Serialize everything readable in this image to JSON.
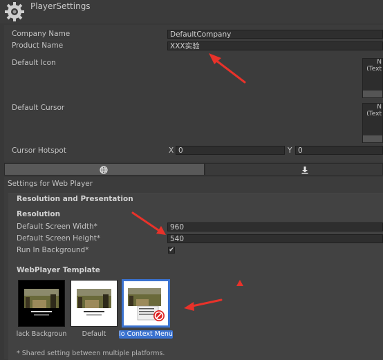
{
  "window": {
    "title": "PlayerSettings"
  },
  "company": {
    "label": "Company Name",
    "value": "DefaultCompany"
  },
  "product": {
    "label": "Product Name",
    "value": "XXX实验"
  },
  "default_icon": {
    "label": "Default Icon",
    "slot_text_1": "N",
    "slot_text_2": "(Text"
  },
  "default_cursor": {
    "label": "Default Cursor",
    "slot_text_1": "N",
    "slot_text_2": "(Text"
  },
  "cursor_hotspot": {
    "label": "Cursor Hotspot",
    "x_label": "X",
    "x_value": "0",
    "y_label": "Y",
    "y_value": "0"
  },
  "tabs": [
    {
      "icon": "globe-icon"
    },
    {
      "icon": "download-icon"
    }
  ],
  "platform_settings_label": "Settings for Web Player",
  "resolution_section": {
    "title": "Resolution and Presentation",
    "subheader": "Resolution",
    "width": {
      "label": "Default Screen Width*",
      "value": "960"
    },
    "height": {
      "label": "Default Screen Height*",
      "value": "540"
    },
    "run_bg": {
      "label": "Run In Background*",
      "checked": true,
      "glyph": "✔"
    }
  },
  "template": {
    "title": "WebPlayer Template",
    "options": [
      {
        "label": "lack Backgroun",
        "selected": false
      },
      {
        "label": "Default",
        "selected": false
      },
      {
        "label": "lo Context Menu",
        "selected": true
      }
    ]
  },
  "footnote": "* Shared setting between multiple platforms.",
  "colors": {
    "accent": "#3a72d0",
    "arrow": "#e8322a"
  }
}
